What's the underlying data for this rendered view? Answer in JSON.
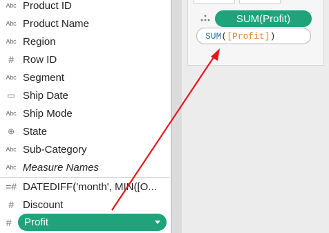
{
  "data_pane": {
    "fields": [
      {
        "icon": "Abc",
        "label": "Product ID",
        "italic": false
      },
      {
        "icon": "Abc",
        "label": "Product Name",
        "italic": false
      },
      {
        "icon": "Abc",
        "label": "Region",
        "italic": false
      },
      {
        "icon": "#",
        "label": "Row ID",
        "italic": false
      },
      {
        "icon": "Abc",
        "label": "Segment",
        "italic": false
      },
      {
        "icon": "▭",
        "label": "Ship Date",
        "italic": false
      },
      {
        "icon": "Abc",
        "label": "Ship Mode",
        "italic": false
      },
      {
        "icon": "⊕",
        "label": "State",
        "italic": false
      },
      {
        "icon": "Abc",
        "label": "Sub-Category",
        "italic": false
      },
      {
        "icon": "Abc",
        "label": "Measure Names",
        "italic": true
      }
    ],
    "measures": [
      {
        "icon": "=#",
        "label": "DATEDIFF('month', MIN([O..."
      },
      {
        "icon": "#",
        "label": "Discount"
      }
    ],
    "selected_measure": {
      "icon": "#",
      "label": "Profit"
    }
  },
  "marks_card": {
    "detail_pill_label": "SUM(Profit)",
    "calc_editor": {
      "function": "SUM",
      "open_paren": "(",
      "field": "[Profit]",
      "close_paren": ")"
    }
  },
  "colors": {
    "pill_green": "#1ea37a",
    "arrow_red": "#e8141b",
    "calc_function": "#2e6fa7",
    "calc_field": "#e08a2c"
  }
}
